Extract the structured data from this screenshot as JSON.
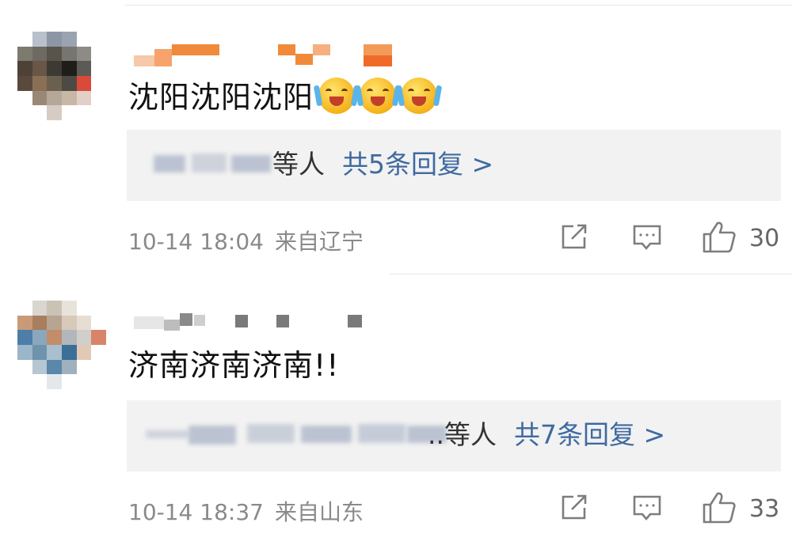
{
  "comments": [
    {
      "text": "沈阳沈阳沈阳",
      "emoji_icon": "laughing-cry-emoji",
      "emoji_count": 3,
      "reply_suffix": "等人",
      "reply_count_text": "共5条回复 >",
      "date": "10-14 18:04",
      "location": "来自辽宁",
      "likes": "30"
    },
    {
      "text": "济南济南济南!!",
      "reply_suffix": "..等人",
      "reply_count_text": "共7条回复 >",
      "date": "10-14 18:37",
      "location": "来自山东",
      "likes": "33"
    }
  ],
  "icons": {
    "share": "share-icon",
    "comment": "comment-icon",
    "like": "thumbs-up-icon"
  },
  "colors": {
    "link": "#3f6aa0",
    "meta": "#8a8a8a",
    "reply_bg": "#f2f2f2"
  }
}
